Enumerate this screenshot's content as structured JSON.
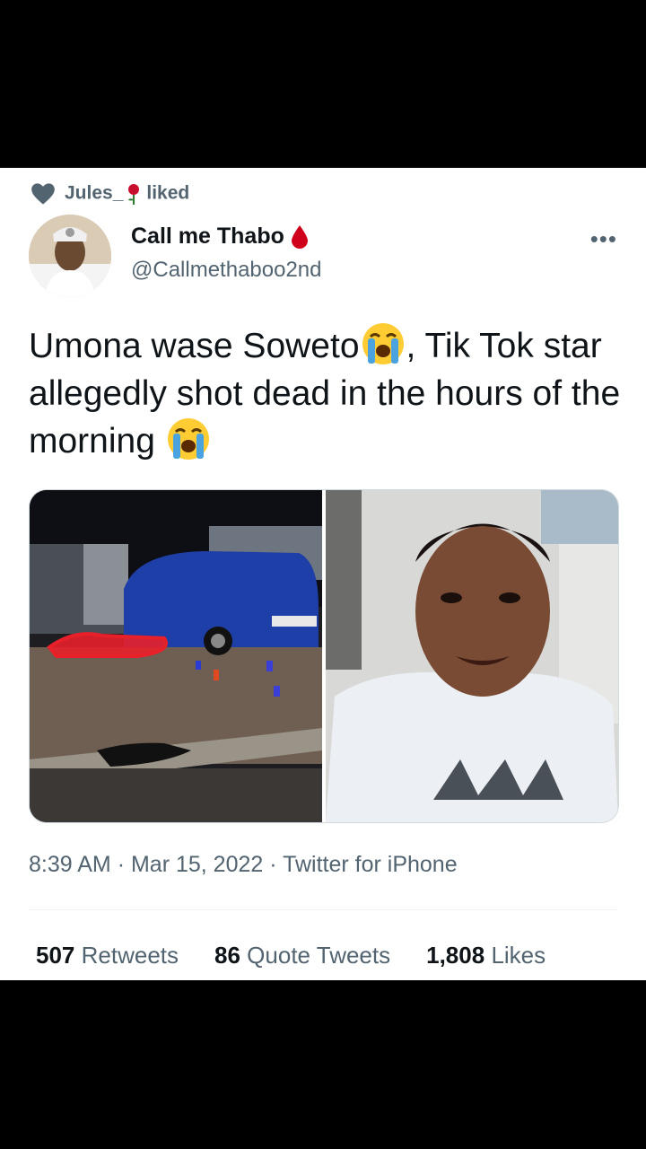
{
  "social_context": {
    "user": "Jules_",
    "action": "liked",
    "icons": [
      "heart-icon",
      "rose-icon"
    ]
  },
  "author": {
    "display_name": "Call me Thabo",
    "handle": "@Callmethaboo2nd",
    "name_emoji": "drop-of-blood-icon"
  },
  "tweet": {
    "text_part1": "Umona wase Soweto",
    "text_part2": ", Tik Tok star allegedly shot dead in the hours of the morning ",
    "emoji": "loudly-crying-face-icon"
  },
  "meta": {
    "time": "8:39 AM",
    "date": "Mar 15, 2022",
    "source": "Twitter for iPhone",
    "separator": "·"
  },
  "stats": {
    "retweets_count": "507",
    "retweets_label": "Retweets",
    "quotes_count": "86",
    "quotes_label": "Quote Tweets",
    "likes_count": "1,808",
    "likes_label": "Likes"
  },
  "colors": {
    "secondary_text": "#536471",
    "primary_text": "#0f1419",
    "background": "#ffffff"
  }
}
